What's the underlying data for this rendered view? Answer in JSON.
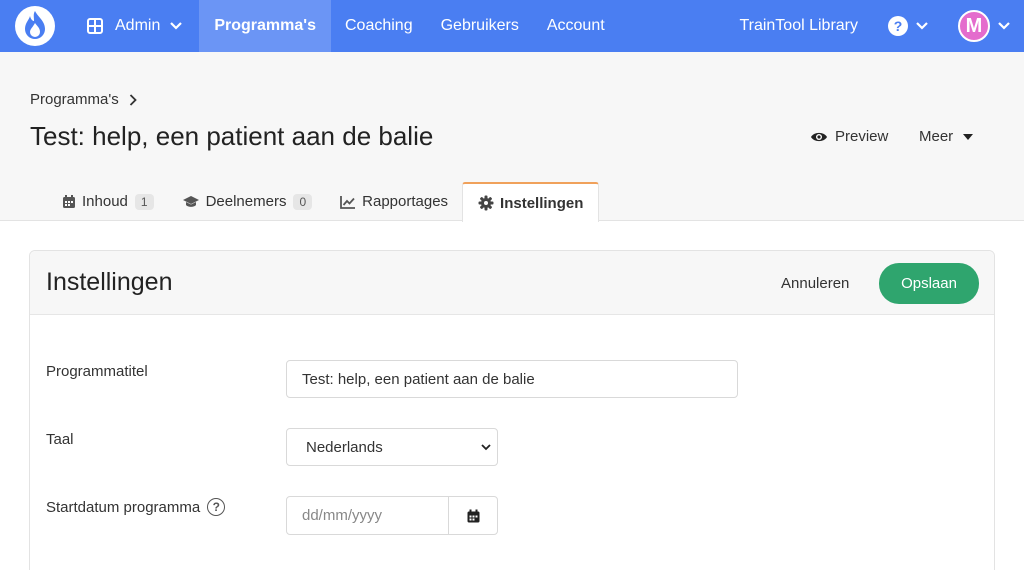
{
  "nav": {
    "admin_label": "Admin",
    "items": [
      {
        "label": "Programma's"
      },
      {
        "label": "Coaching"
      },
      {
        "label": "Gebruikers"
      },
      {
        "label": "Account"
      }
    ],
    "library_label": "TrainTool Library",
    "help_glyph": "?",
    "avatar_initial": "M",
    "colors": {
      "nav_bg": "#4a7ef2",
      "nav_active": "#6b95f5",
      "avatar": "#e46ccd"
    }
  },
  "page": {
    "breadcrumb": "Programma's",
    "title": "Test: help, een patient aan de balie",
    "preview_label": "Preview",
    "more_label": "Meer"
  },
  "tabs": [
    {
      "label": "Inhoud",
      "count": "1",
      "icon": "calendar-icon"
    },
    {
      "label": "Deelnemers",
      "count": "0",
      "icon": "graduation-cap-icon"
    },
    {
      "label": "Rapportages",
      "icon": "chart-line-icon"
    },
    {
      "label": "Instellingen",
      "icon": "gear-icon",
      "active": true
    }
  ],
  "settings": {
    "title": "Instellingen",
    "cancel_label": "Annuleren",
    "save_label": "Opslaan",
    "save_color": "#2fa56e",
    "fields": {
      "program_title": {
        "label": "Programmatitel",
        "value": "Test: help, een patient aan de balie"
      },
      "language": {
        "label": "Taal",
        "value": "Nederlands"
      },
      "start_date": {
        "label": "Startdatum programma",
        "placeholder": "dd/mm/yyyy",
        "help_glyph": "?"
      }
    }
  }
}
